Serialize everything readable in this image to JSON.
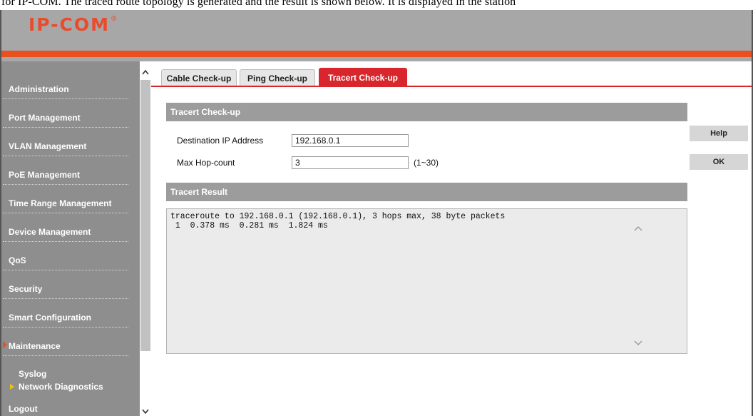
{
  "caption": "for IP-COM. The traced route topology is generated and the result is shown below. It is displayed in the station",
  "brand": {
    "logo_text": "IP-COM",
    "logo_mark": "®",
    "accent": "#e8501f"
  },
  "sidebar": {
    "items": [
      {
        "label": "Administration"
      },
      {
        "label": "Port Management"
      },
      {
        "label": "VLAN Management"
      },
      {
        "label": "PoE Management"
      },
      {
        "label": "Time Range Management"
      },
      {
        "label": "Device Management"
      },
      {
        "label": "QoS"
      },
      {
        "label": "Security"
      },
      {
        "label": "Smart Configuration"
      },
      {
        "label": "Maintenance"
      }
    ],
    "sub_items": [
      {
        "label": "Syslog"
      },
      {
        "label": "Network Diagnostics"
      }
    ],
    "logout": "Logout"
  },
  "tabs": [
    {
      "label": "Cable Check-up"
    },
    {
      "label": "Ping Check-up"
    },
    {
      "label": "Tracert Check-up"
    }
  ],
  "section_title": "Tracert Check-up",
  "form": {
    "dest_label": "Destination IP Address",
    "dest_value": "192.168.0.1",
    "hop_label": "Max Hop-count",
    "hop_value": "3",
    "hop_range": "(1~30)"
  },
  "result": {
    "title": "Tracert Result",
    "lines": [
      "traceroute to 192.168.0.1 (192.168.0.1), 3 hops max, 38 byte packets",
      " 1  0.378 ms  0.281 ms  1.824 ms"
    ]
  },
  "buttons": {
    "help": "Help",
    "ok": "OK"
  },
  "colors": {
    "header_gray": "#a7a7a7",
    "sidebar_gray": "#8e8e8e",
    "tab_red": "#d8262c",
    "marker_yellow": "#f5c400"
  }
}
